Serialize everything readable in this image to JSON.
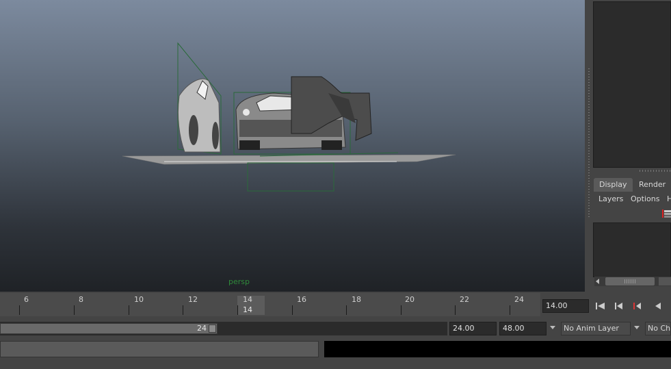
{
  "viewport": {
    "camera_label": "persp"
  },
  "right_panel": {
    "tabs": [
      "Display",
      "Render"
    ],
    "menu": [
      "Layers",
      "Options",
      "H"
    ]
  },
  "timeline": {
    "tick_labels": [
      "6",
      "8",
      "10",
      "12",
      "14",
      "16",
      "18",
      "20",
      "22",
      "24"
    ],
    "current_frame": "14",
    "current_frame_field": "14.00"
  },
  "range": {
    "bar_end_label": "24",
    "end_time": "24.00",
    "total_end": "48.00",
    "anim_layer": "No Anim Layer",
    "character_set": "No Cha"
  }
}
